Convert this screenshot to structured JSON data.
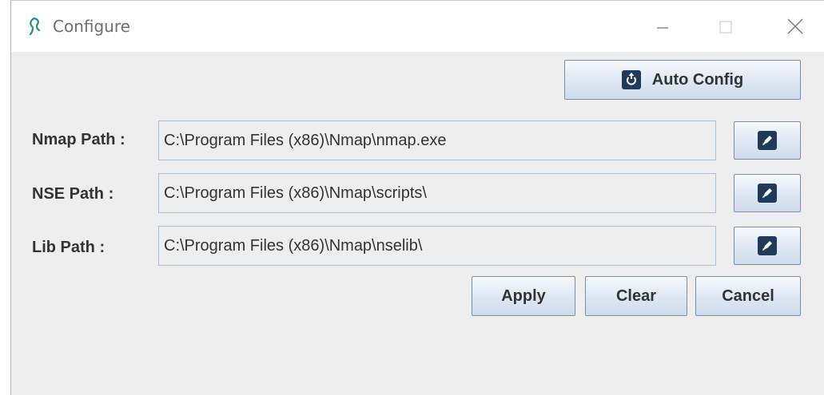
{
  "window": {
    "title": "Configure",
    "controls": [
      "minimize",
      "maximize",
      "close"
    ]
  },
  "toolbar": {
    "auto_config_label": "Auto Config",
    "auto_config_icon": "refresh-icon"
  },
  "paths": [
    {
      "label": "Nmap Path :",
      "value": "C:\\Program Files (x86)\\Nmap\\nmap.exe",
      "button_icon": "edit-icon"
    },
    {
      "label": "NSE Path :",
      "value": "C:\\Program Files (x86)\\Nmap\\scripts\\",
      "button_icon": "edit-icon"
    },
    {
      "label": "Lib Path :",
      "value": "C:\\Program Files (x86)\\Nmap\\nselib\\",
      "button_icon": "edit-icon"
    }
  ],
  "actions": {
    "apply_label": "Apply",
    "clear_label": "Clear",
    "cancel_label": "Cancel"
  },
  "colors": {
    "window_bg": "#eeeeee",
    "button_icon_bg": "#1f3a5a",
    "field_border": "#a9c0da",
    "app_icon_color": "#1c8f8f"
  }
}
